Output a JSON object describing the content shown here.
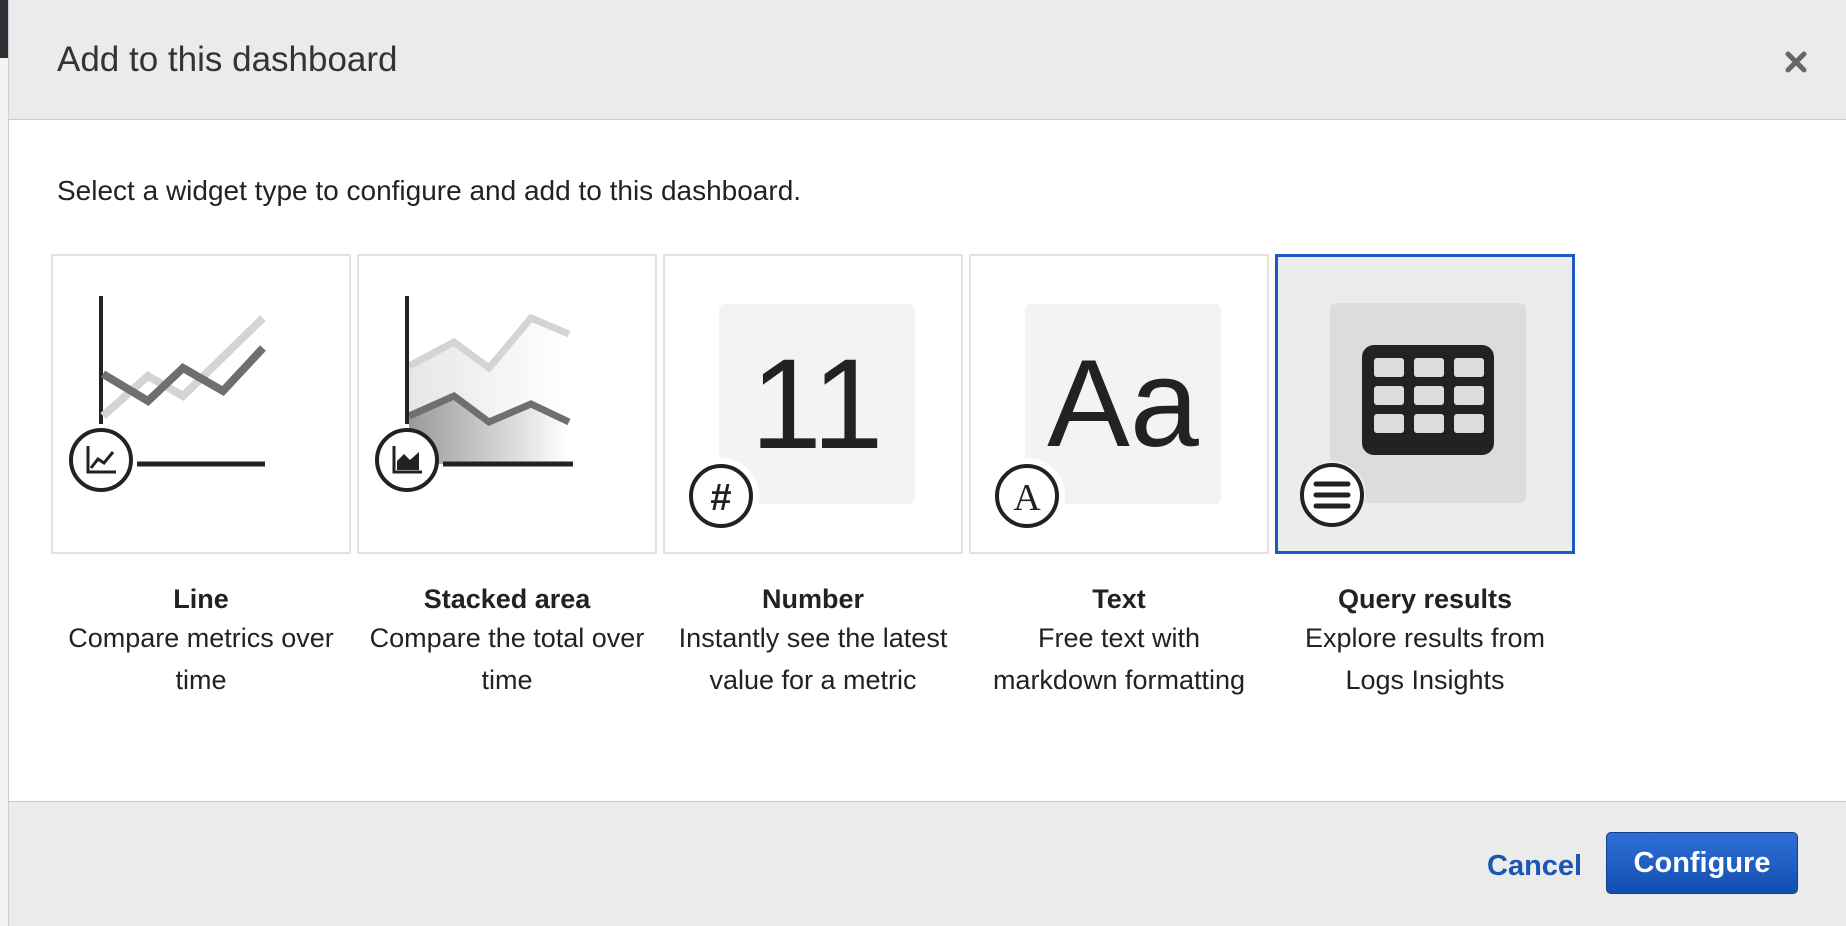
{
  "modal": {
    "title": "Add to this dashboard",
    "intro": "Select a widget type to configure and add to this dashboard."
  },
  "widgets": [
    {
      "name": "Line",
      "description": "Compare metrics over time",
      "icon": "line-chart-icon"
    },
    {
      "name": "Stacked area",
      "description": "Compare the total over time",
      "icon": "area-chart-icon"
    },
    {
      "name": "Number",
      "description": "Instantly see the latest value for a metric",
      "icon": "hash-icon",
      "preview_text": "11"
    },
    {
      "name": "Text",
      "description": "Free text with markdown formatting",
      "icon": "text-icon",
      "preview_text": "Aa",
      "badge_text": "A"
    },
    {
      "name": "Query results",
      "description": "Explore results from Logs Insights",
      "icon": "list-icon",
      "selected": true
    }
  ],
  "footer": {
    "cancel_label": "Cancel",
    "configure_label": "Configure"
  },
  "colors": {
    "accent": "#1b5cc4",
    "header_bg": "#ebebeb"
  }
}
